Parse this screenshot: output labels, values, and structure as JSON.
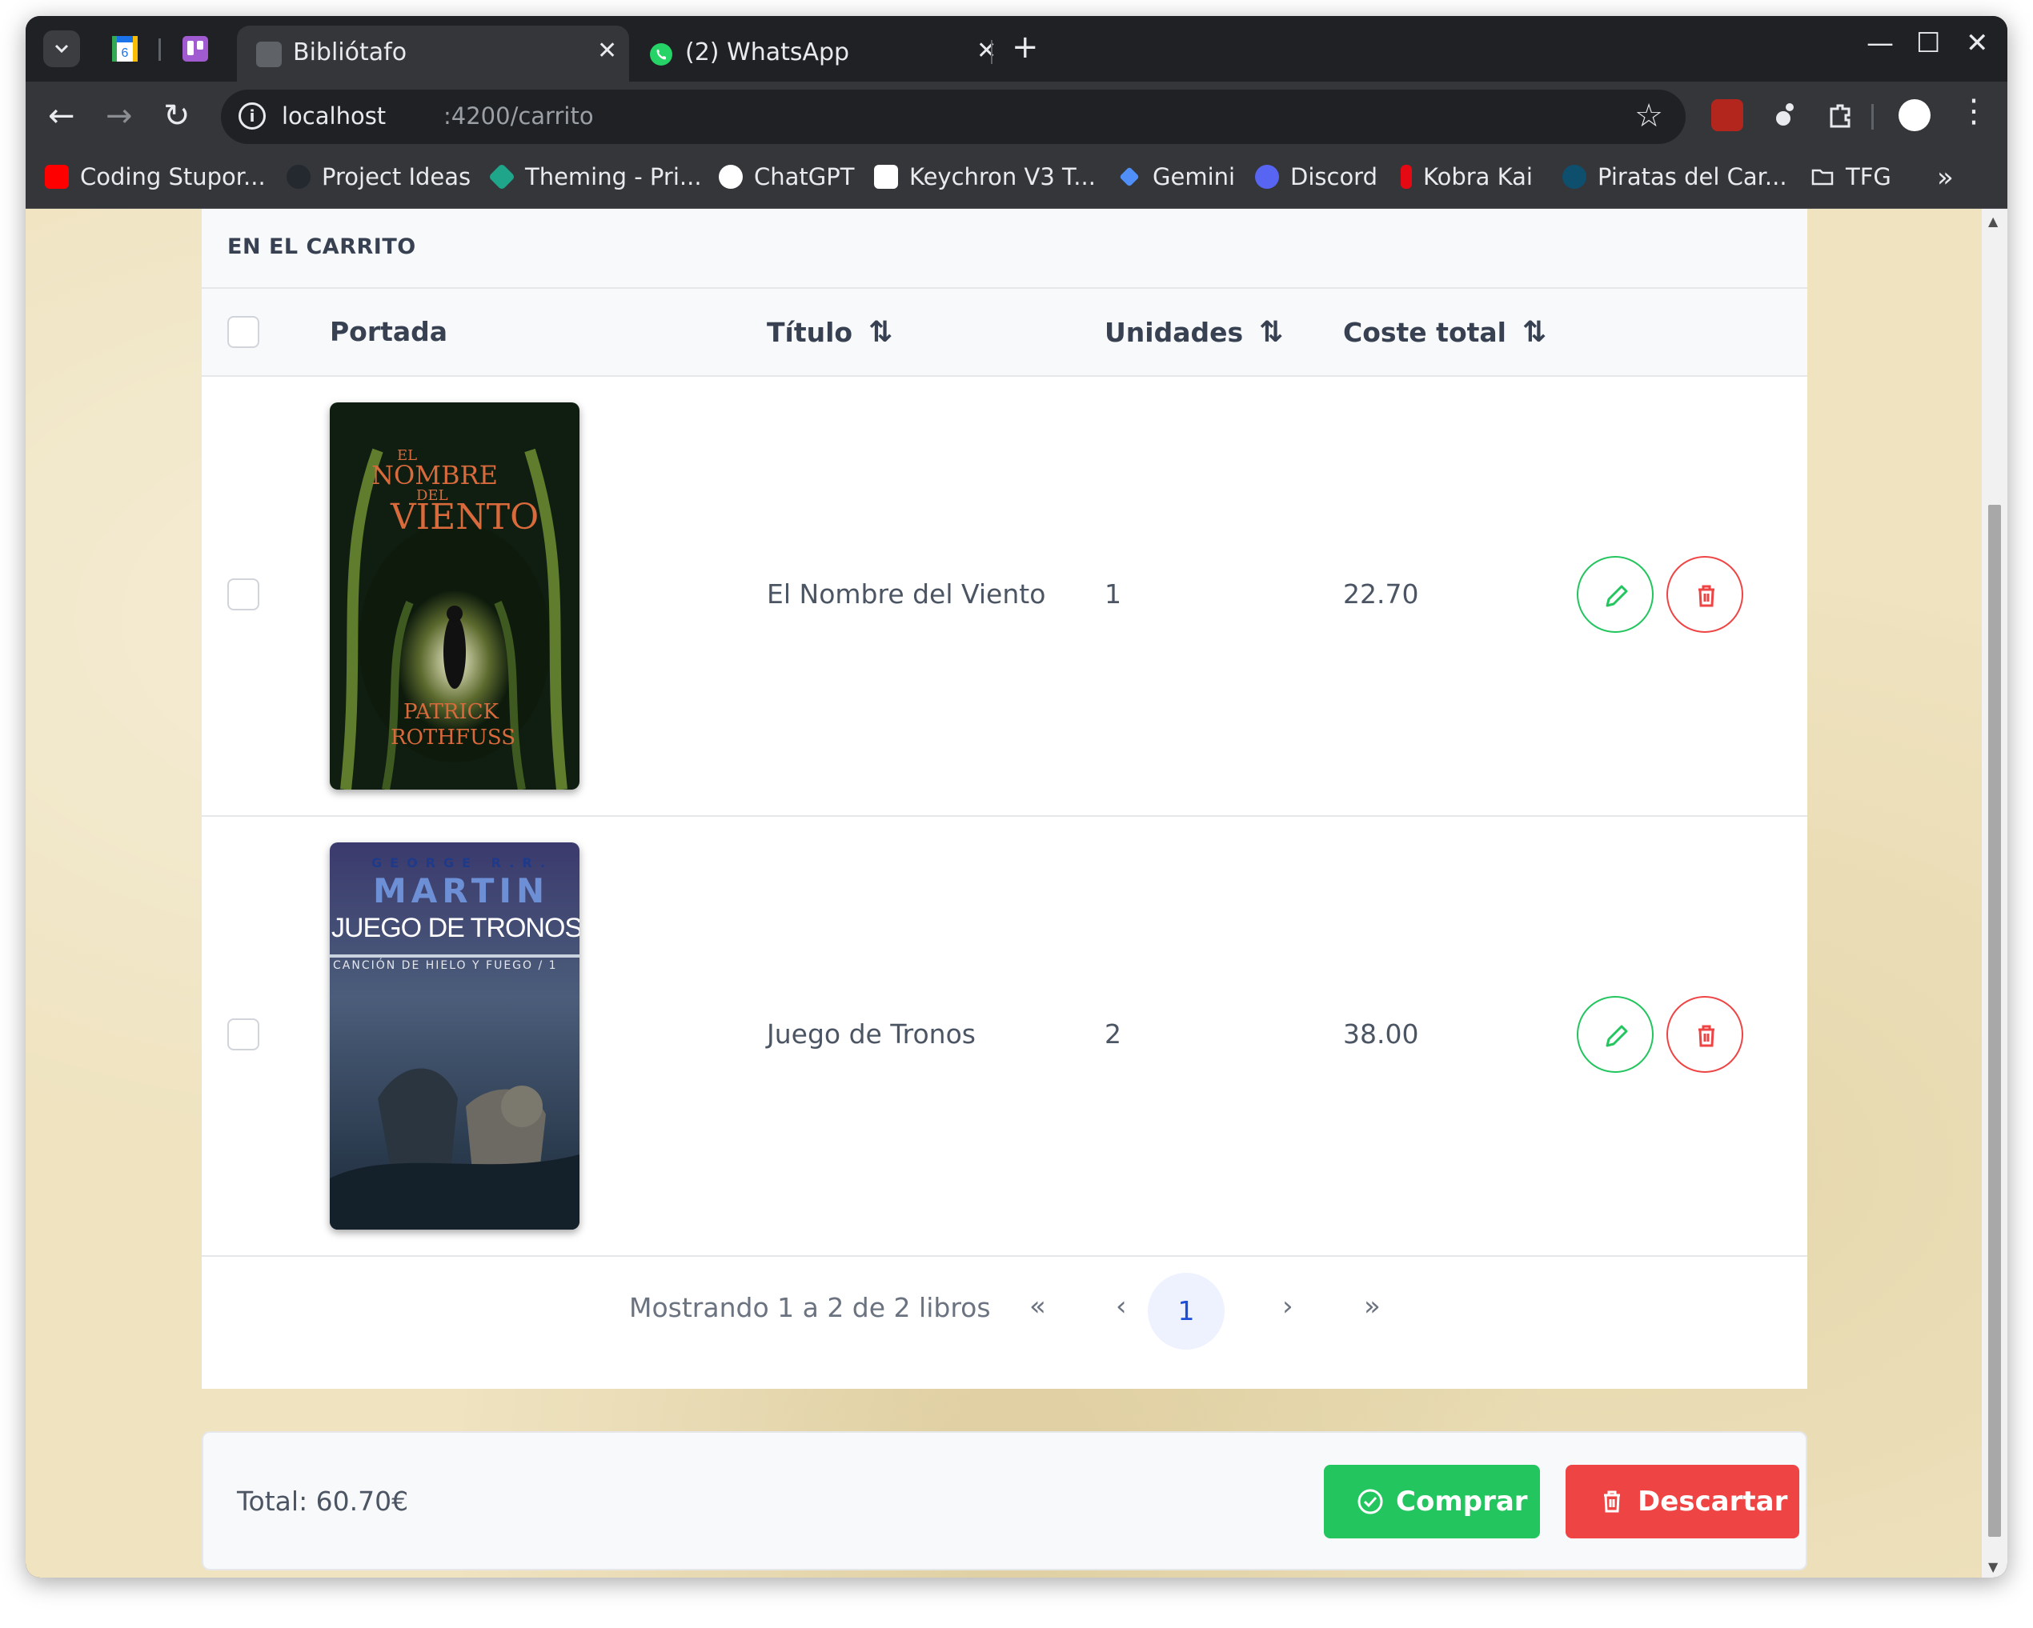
{
  "browser": {
    "tabs": [
      {
        "title": "Bibliótafo",
        "active": true
      },
      {
        "title": "(2) WhatsApp",
        "active": false
      }
    ],
    "url_host": "localhost",
    "url_path": ":4200/carrito",
    "bookmarks": [
      {
        "label": "Coding Stupor...",
        "icon": "youtube-icon"
      },
      {
        "label": "Project Ideas",
        "icon": "github-icon"
      },
      {
        "label": "Theming - Pri...",
        "icon": "primeng-icon"
      },
      {
        "label": "ChatGPT",
        "icon": "chatgpt-icon"
      },
      {
        "label": "Keychron V3 T...",
        "icon": "amazon-icon"
      },
      {
        "label": "Gemini",
        "icon": "gemini-icon"
      },
      {
        "label": "Discord",
        "icon": "discord-icon"
      },
      {
        "label": "Kobra Kai",
        "icon": "netflix-icon"
      },
      {
        "label": "Piratas del Car...",
        "icon": "disney-icon"
      },
      {
        "label": "TFG",
        "icon": "folder-icon"
      }
    ]
  },
  "cart": {
    "section_title": "EN EL CARRITO",
    "columns": {
      "cover": "Portada",
      "title": "Título",
      "units": "Unidades",
      "total_cost": "Coste total"
    },
    "rows": [
      {
        "title": "El Nombre del Viento",
        "units": "1",
        "cost": "22.70",
        "cover_lines": [
          "EL",
          "NOMBRE",
          "DEL",
          "VIENTO",
          "PATRICK",
          "ROTHFUSS"
        ]
      },
      {
        "title": "Juego de Tronos",
        "units": "2",
        "cost": "38.00",
        "cover_lines": [
          "GEORGE R.R.",
          "MARTIN",
          "JUEGO DE TRONOS",
          "CANCIÓN DE HIELO Y FUEGO / 1"
        ]
      }
    ],
    "pagination": {
      "summary": "Mostrando 1 a 2 de 2 libros",
      "current_page": "1"
    }
  },
  "footer": {
    "total": "Total: 60.70€",
    "buy_label": "Comprar",
    "discard_label": "Descartar"
  },
  "colors": {
    "success": "#22c55e",
    "danger": "#ef4444",
    "page_background": "#efe3c0"
  }
}
